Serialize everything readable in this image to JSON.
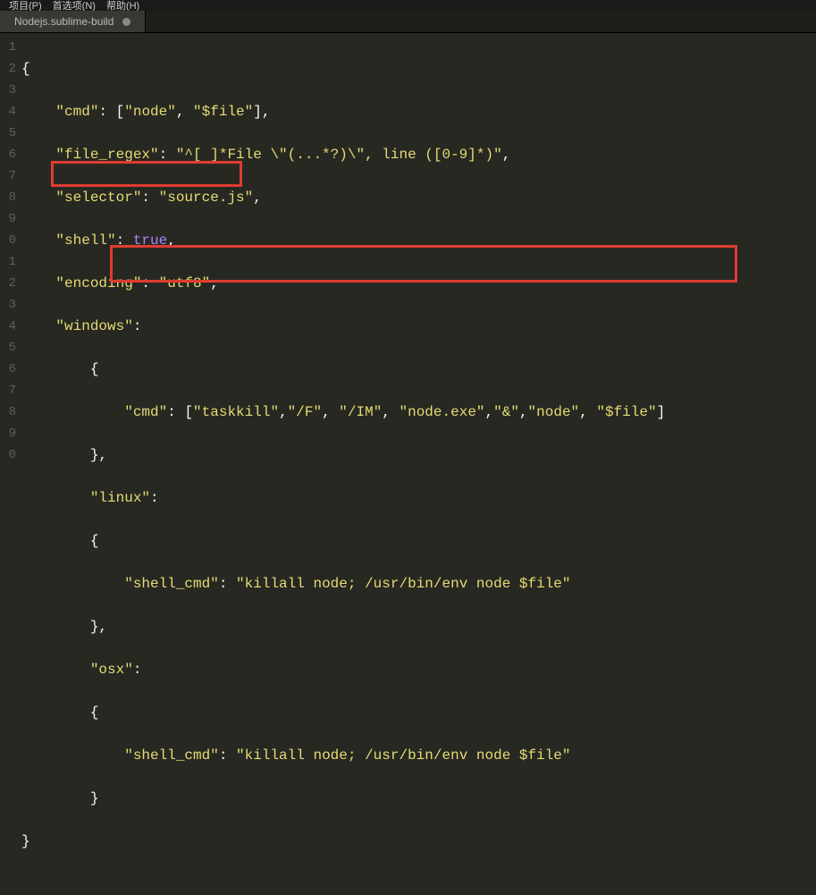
{
  "menubar": {
    "items": [
      "项目(P)",
      "首选项(N)",
      "帮助(H)"
    ]
  },
  "tab": {
    "name": "Nodejs.sublime-build",
    "dirty": true
  },
  "gutter": {
    "lines": [
      "1",
      "2",
      "3",
      "4",
      "5",
      "6",
      "7",
      "8",
      "9",
      "0",
      "1",
      "2",
      "3",
      "4",
      "5",
      "6",
      "7",
      "8",
      "9",
      "0"
    ]
  },
  "code": {
    "l1": "{",
    "l2_k": "\"cmd\"",
    "l2_p1": ": [",
    "l2_s1": "\"node\"",
    "l2_p2": ", ",
    "l2_s2": "\"$file\"",
    "l2_p3": "],",
    "l3_k": "\"file_regex\"",
    "l3_p1": ": ",
    "l3_s": "\"^[ ]*File \\\"(...*?)\\\", line ([0-9]*)\"",
    "l3_p2": ",",
    "l4_k": "\"selector\"",
    "l4_p1": ": ",
    "l4_s": "\"source.js\"",
    "l4_p2": ",",
    "l5_k": "\"shell\"",
    "l5_p1": ": ",
    "l5_c": "true",
    "l5_p2": ",",
    "l6_k": "\"encoding\"",
    "l6_p1": ": ",
    "l6_s": "\"utf8\"",
    "l6_p2": ",",
    "l7_k": "\"windows\"",
    "l7_p1": ":",
    "l8": "{",
    "l9_k": "\"cmd\"",
    "l9_p1": ": [",
    "l9_s1": "\"taskkill\"",
    "l9_p2": ",",
    "l9_s2": "\"/F\"",
    "l9_p3": ", ",
    "l9_s3": "\"/IM\"",
    "l9_p4": ", ",
    "l9_s4": "\"node.exe\"",
    "l9_p5": ",",
    "l9_s5": "\"&\"",
    "l9_p6": ",",
    "l9_s6": "\"node\"",
    "l9_p7": ", ",
    "l9_s7": "\"$file\"",
    "l9_p8": "]",
    "l10": "},",
    "l11_k": "\"linux\"",
    "l11_p1": ":",
    "l12": "{",
    "l13_k": "\"shell_cmd\"",
    "l13_p1": ": ",
    "l13_s": "\"killall node; /usr/bin/env node $file\"",
    "l14": "},",
    "l15_k": "\"osx\"",
    "l15_p1": ":",
    "l16": "{",
    "l17_k": "\"shell_cmd\"",
    "l17_p1": ": ",
    "l17_s": "\"killall node; /usr/bin/env node $file\"",
    "l18": "}",
    "l19": "}"
  }
}
